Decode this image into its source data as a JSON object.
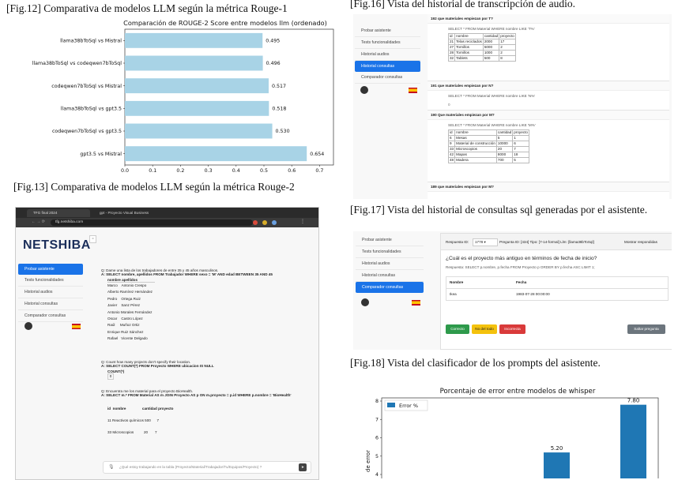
{
  "captions": {
    "fig12": "[Fig.12] Comparativa de modelos LLM según la métrica Rouge-1",
    "fig13": "[Fig.13] Comparativa de modelos LLM según la métrica Rouge-2",
    "fig16": "[Fig.16] Vista del historial de transcripción de audio.",
    "fig17": "[Fig.17] Vista del historial de consultas sql generadas por el asistente.",
    "fig18": "[Fig.18] Vista del clasificador de los prompts del asistente."
  },
  "chart_data": [
    {
      "type": "bar",
      "orientation": "horizontal",
      "title": "Comparación de ROUGE-2 Score entre modelos llm (ordenado)",
      "xlabel": "ROUGE-2 Score",
      "ylabel": "",
      "xlim": [
        0,
        0.75
      ],
      "xticks": [
        "0.0",
        "0.1",
        "0.2",
        "0.3",
        "0.4",
        "0.5",
        "0.6",
        "0.7"
      ],
      "categories": [
        "llama38bToSql vs Mistral",
        "llama38bToSql vs codeqwen7bToSql",
        "codeqwen7bToSql vs Mistral",
        "llama38bToSql vs gpt3.5",
        "codeqwen7bToSql vs gpt3.5",
        "gpt3.5 vs Mistral"
      ],
      "values": [
        0.495,
        0.496,
        0.517,
        0.518,
        0.53,
        0.654
      ],
      "value_labels": [
        "0.495",
        "0.496",
        "0.517",
        "0.518",
        "0.530",
        "0.654"
      ],
      "color": "#a8d3e6"
    },
    {
      "type": "bar",
      "title": "Porcentaje de error entre modelos de whisper",
      "ylabel": "de error",
      "legend": "Error %",
      "legend_position": "top-left",
      "yticks": [
        "4",
        "5",
        "6",
        "7",
        "8"
      ],
      "values": [
        5.2,
        7.8
      ],
      "value_labels": [
        "5.20",
        "7.80"
      ],
      "color": "#1f77b4"
    }
  ],
  "fig13_app": {
    "tabs": [
      "TFG final 2024",
      "gpt - Proyecto Visual Business"
    ],
    "url": "tfg.netshiba.com",
    "logo": "NETSHIBA",
    "menu": [
      "Probar asistente",
      "Tests funcionalidades",
      "Historial audios",
      "Historial consultas",
      "Comparador consultas"
    ],
    "active_menu": 0,
    "q1": "Q: Dame una lista de los trabajadores de entre 35 y 45 años masculinos.",
    "a1": "A: SELECT nombre, apellidos FROM Trabajador WHERE sexo = 'M' AND edad BETWEEN 35 AND 45",
    "t1_header": "nombre apellidos",
    "t1_rows": [
      "Marco    Antonio Crespo",
      "Alberto Ramírez Hernández",
      "Pedro    Ortega Ruiz",
      "Javier    Sanz Pérez",
      "Antonio Morales Fernández",
      "Oscar    Castro López",
      "Raúl     Muñoz Ortiz",
      "Enrique Ruiz Sánchez",
      "Rafael   Vicente Delgado"
    ],
    "q2": "Q: Count how many projects don't specify their location.",
    "a2": "A: SELECT COUNT(*) FROM Proyecto WHERE ubicacion IS NULL",
    "t2_header": "COUNT(*)",
    "t2_rows": [
      "0"
    ],
    "q3": "Q: Encuentra me los material para el proyecto BioHealth.",
    "a3": "A: SELECT m.* FROM Material AS m JOIN Proyecto AS p ON m.proyecto = p.id WHERE p.nombre = 'BioHealth'",
    "t3_header": "id  nombre                cantidad proyecto",
    "t3_rows": [
      "11 Reactivos químicos 500      7",
      "33 Microscopios          20       7"
    ],
    "input_placeholder": "¿Qué estoy trabajando en la tabla (Proyecto/Material/Trabajador/Tu/Equipos/Proyecto) ?"
  },
  "fig16_app": {
    "menu": [
      "Probar asistente",
      "Tests funcionalidades",
      "Historial audios",
      "Historial consultas",
      "Comparador consultas"
    ],
    "active_menu": 3,
    "entries": [
      {
        "id": "192",
        "question": "que materiales empiezan por T?",
        "sql": "SELECT * FROM Material WHERE nombre LIKE 'T%'",
        "header": [
          "id",
          "nombre",
          "cantidad",
          "proyecto"
        ],
        "rows": [
          [
            "21",
            "Telas reciclados",
            "2000",
            "17"
          ],
          [
            "27",
            "Tornillos",
            "5000",
            "2"
          ],
          [
            "28",
            "Tornillos",
            "1000",
            "2"
          ],
          [
            "32",
            "Tablets",
            "500",
            "8"
          ]
        ]
      },
      {
        "id": "191",
        "question": "que materiales empiezan por N?",
        "sql": "SELECT * FROM Material WHERE nombre LIKE 'N%'",
        "header": [],
        "rows": [],
        "empty": "0"
      },
      {
        "id": "190",
        "question": "Que materiales empiezan por M?",
        "sql": "SELECT * FROM Material WHERE nombre LIKE 'M%'",
        "header": [
          "id",
          "nombre",
          "cantidad",
          "proyecto"
        ],
        "rows": [
          [
            "6",
            "Mesas",
            "5",
            "1"
          ],
          [
            "9",
            "Material de construcción",
            "10000",
            "6"
          ],
          [
            "33",
            "Microscopios",
            "20",
            "7"
          ],
          [
            "42",
            "Mapas",
            "8000",
            "18"
          ],
          [
            "48",
            "Madera",
            "700",
            "5"
          ]
        ]
      },
      {
        "id": "189",
        "question": "que materiales empiezan por M?",
        "sql": "",
        "header": [],
        "rows": []
      }
    ]
  },
  "fig17_app": {
    "menu": [
      "Probar asistente",
      "Tests funcionalidades",
      "Historial audios",
      "Historial consultas",
      "Comparador consultas"
    ],
    "active_menu": 4,
    "req_label": "Respuesta ID:",
    "req_value": "1778",
    "question_line": "Pregunta ID: [434]  Tipo: [7-14-formal]  Llm: [llama38bToSql]",
    "show_label": "Mostrar respondidas",
    "question": "¿Cuál es el proyecto más antiguo en términos de fecha de inicio?",
    "answer": "Respuesta: SELECT p.nombre, p.fecha FROM Proyecto p ORDER BY p.fecha ASC LIMIT 1;",
    "col1": "Nombre",
    "col2": "Fecha",
    "cell1": "Ikea",
    "cell2": "1983-07-28 00:00:00",
    "btn_correct": "Correcto",
    "btn_unknown": "No del todo",
    "btn_wrong": "Incorrecta",
    "btn_skip": "Saltar pregunta",
    "colors": {
      "correct": "#2e9a4b",
      "unknown": "#f4c20d",
      "wrong": "#d93a3a",
      "skip": "#6c757d",
      "accent": "#1a73e8"
    }
  }
}
